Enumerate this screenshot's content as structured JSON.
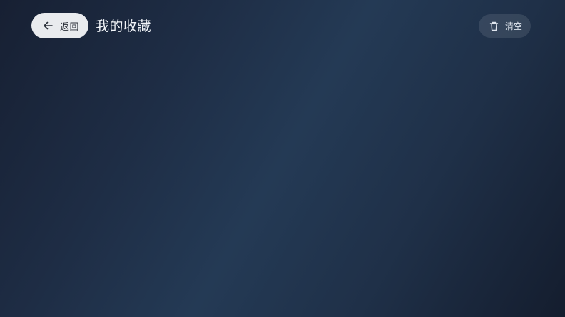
{
  "header": {
    "back_label": "返回",
    "title": "我的收藏",
    "clear_label": "清空",
    "back_icon": "arrow-left-icon",
    "clear_icon": "trash-icon"
  },
  "colors": {
    "background_dark": "#172033",
    "background_mid": "#243a55",
    "back_button_bg": "#e9ebee",
    "back_button_text": "#2a2f38",
    "title_text": "#f1f4f8"
  }
}
